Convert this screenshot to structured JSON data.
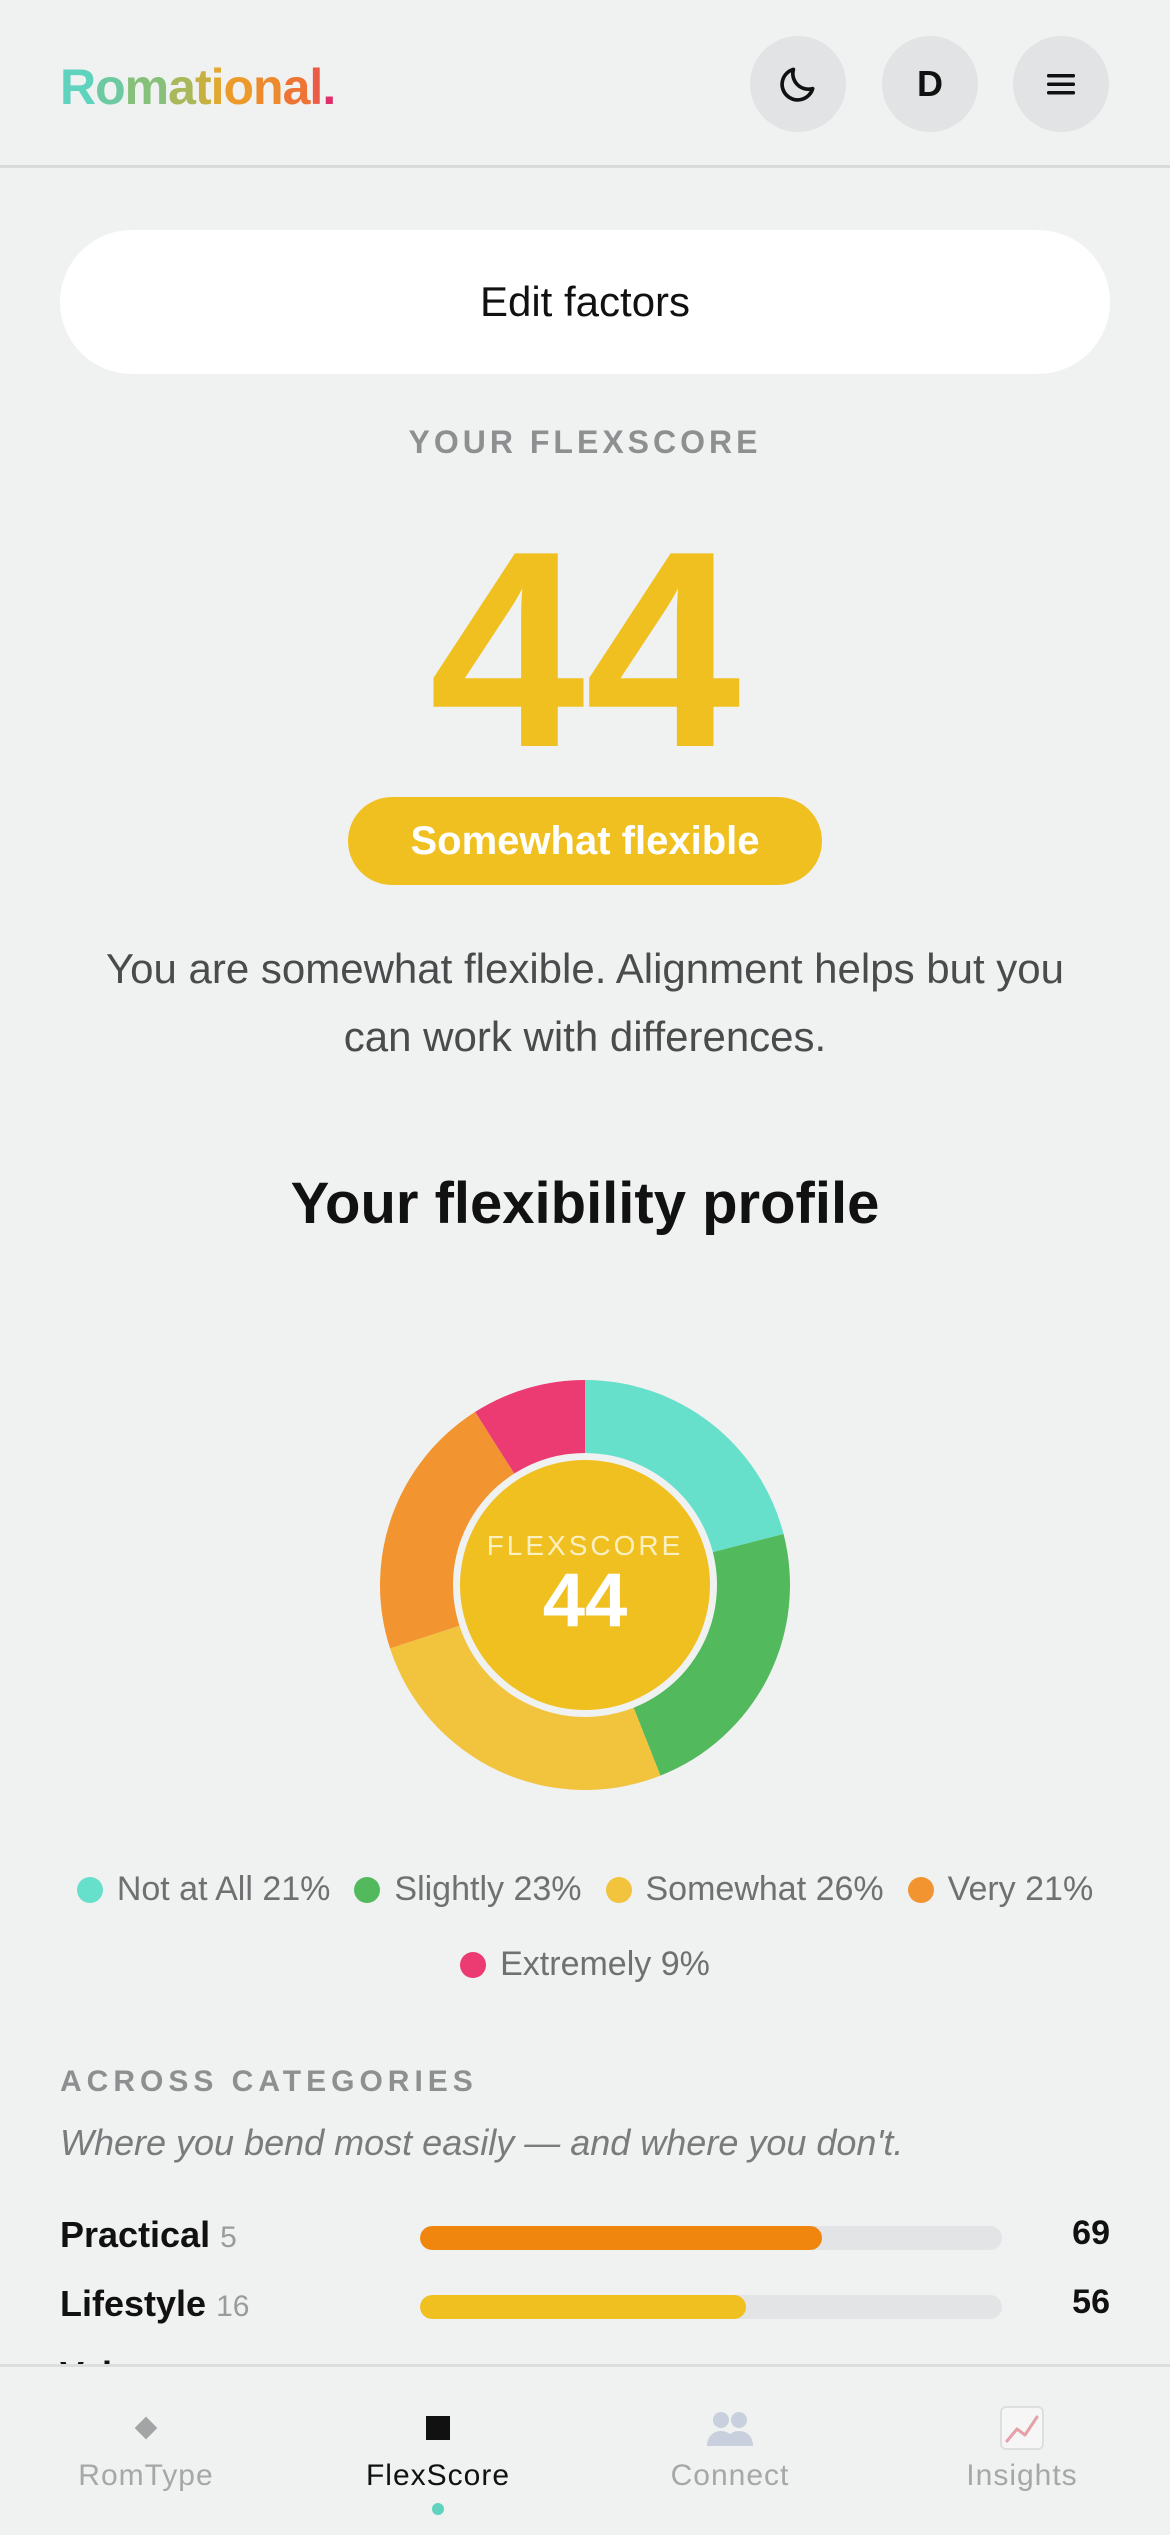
{
  "header": {
    "logo_letters": [
      {
        "ch": "R",
        "color": "#5fd3bd"
      },
      {
        "ch": "o",
        "color": "#6cc9a2"
      },
      {
        "ch": "m",
        "color": "#86c07a"
      },
      {
        "ch": "a",
        "color": "#a9b85a"
      },
      {
        "ch": "t",
        "color": "#c8b040"
      },
      {
        "ch": "i",
        "color": "#e0a830"
      },
      {
        "ch": "o",
        "color": "#ec9a2a"
      },
      {
        "ch": "n",
        "color": "#ee8a2e"
      },
      {
        "ch": "a",
        "color": "#ee7436"
      },
      {
        "ch": "l",
        "color": "#ea5c46"
      },
      {
        "ch": ".",
        "color": "#e0306a"
      }
    ],
    "user_initial": "D",
    "icons": {
      "theme": "moon-icon",
      "menu": "hamburger-icon"
    }
  },
  "edit_button_label": "Edit factors",
  "score_section": {
    "kicker": "YOUR FLEXSCORE",
    "score": "44",
    "badge": "Somewhat flexible",
    "description": "You are somewhat flexible. Alignment helps but you can work with differences."
  },
  "profile": {
    "title": "Your flexibility profile",
    "center_label": "FLEXSCORE",
    "center_value": "44"
  },
  "chart_data": {
    "type": "pie",
    "variant": "donut",
    "categories": [
      "Not at All",
      "Slightly",
      "Somewhat",
      "Very",
      "Extremely"
    ],
    "values": [
      21,
      23,
      26,
      21,
      9
    ],
    "legend_labels": [
      "Not at All 21%",
      "Slightly 23%",
      "Somewhat 26%",
      "Very 21%",
      "Extremely 9%"
    ],
    "colors": [
      "#66dfcb",
      "#52b95c",
      "#f2c33c",
      "#f29530",
      "#ec3a72"
    ],
    "center_color": "#f0c020",
    "legend_placement": "bottom"
  },
  "categories": {
    "kicker": "ACROSS CATEGORIES",
    "subtitle": "Where you bend most easily — and where you don't.",
    "rows": [
      {
        "label": "Practical",
        "count": "5",
        "value": "69",
        "fraction": 0.69,
        "color": "#f0860e"
      },
      {
        "label": "Lifestyle",
        "count": "16",
        "value": "56",
        "fraction": 0.56,
        "color": "#f0c020"
      }
    ],
    "peek_label": "Values"
  },
  "tabs": [
    {
      "label": "RomType",
      "icon": "diamond-icon",
      "active": false
    },
    {
      "label": "FlexScore",
      "icon": "square-icon",
      "active": true
    },
    {
      "label": "Connect",
      "icon": "people-icon",
      "active": false
    },
    {
      "label": "Insights",
      "icon": "chart-icon",
      "active": false
    }
  ]
}
